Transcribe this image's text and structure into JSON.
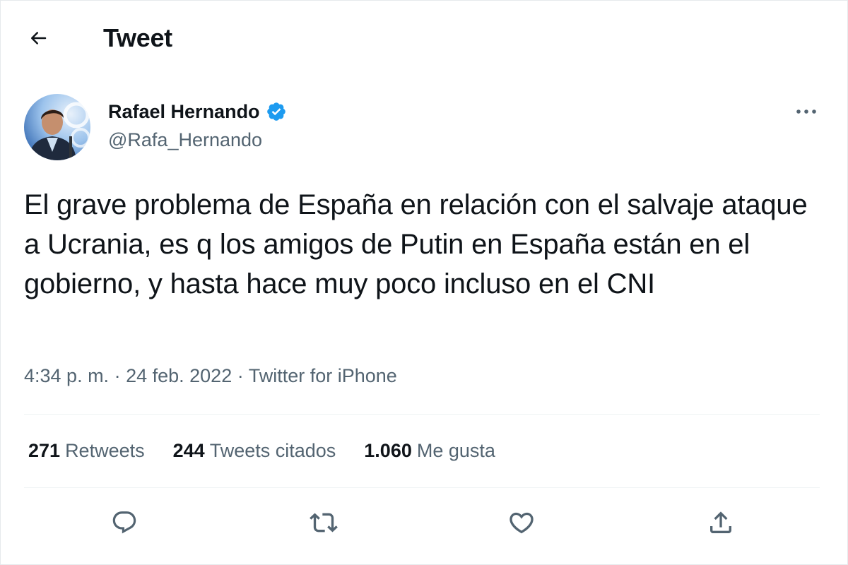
{
  "header": {
    "title": "Tweet",
    "back_icon": "arrow-left-icon"
  },
  "author": {
    "display_name": "Rafael Hernando",
    "handle": "@Rafa_Hernando",
    "verified": true,
    "verified_color": "#1d9bf0"
  },
  "tweet": {
    "text": "El grave problema de España en relación con el salvaje ataque a Ucrania, es q los amigos de Putin en España están en el gobierno, y hasta hace muy poco incluso en el CNI"
  },
  "meta": {
    "time": "4:34 p. m.",
    "separator": " · ",
    "date": "24 feb. 2022",
    "source": "Twitter for iPhone"
  },
  "stats": [
    {
      "count": "271",
      "label": "Retweets"
    },
    {
      "count": "244",
      "label": "Tweets citados"
    },
    {
      "count": "1.060",
      "label": "Me gusta"
    }
  ],
  "actions": [
    {
      "name": "reply",
      "icon": "speech-bubble-icon"
    },
    {
      "name": "retweet",
      "icon": "retweet-icon"
    },
    {
      "name": "like",
      "icon": "heart-icon"
    },
    {
      "name": "share",
      "icon": "share-upload-icon"
    }
  ],
  "colors": {
    "text_primary": "#0f1419",
    "text_secondary": "#536471",
    "divider": "#eff3f4",
    "accent": "#1d9bf0"
  }
}
